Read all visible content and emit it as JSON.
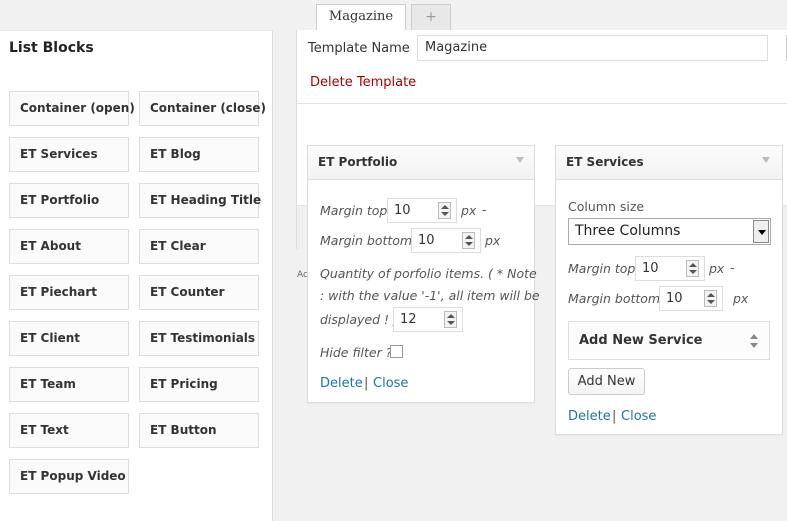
{
  "tabs": {
    "active": "Magazine",
    "add": "+"
  },
  "sidebar": {
    "title": "List Blocks",
    "blocks": [
      "Container (open)",
      "Container (close)",
      "ET Services",
      "ET Blog",
      "ET Portfolio",
      "ET Heading Title",
      "ET About",
      "ET Clear",
      "ET Piechart",
      "ET Counter",
      "ET Client",
      "ET Testimonials",
      "ET Team",
      "ET Pricing",
      "ET Text",
      "ET Button",
      "ET Popup Video"
    ]
  },
  "template": {
    "name_label": "Template Name",
    "name_value": "Magazine",
    "delete_label": "Delete Template"
  },
  "stub_text": "Ac",
  "portfolio": {
    "title": "ET Portfolio",
    "margin_top_label": "Margin top",
    "margin_top_value": "10",
    "margin_top_unit": "px",
    "margin_dash": "-",
    "margin_bottom_label": "Margin bottom",
    "margin_bottom_value": "10",
    "margin_bottom_unit": "px",
    "quantity_label_1": "Quantity of porfolio items. ( * Note",
    "quantity_label_2": ": with the value '-1', all item will be",
    "quantity_label_3": "displayed ! )",
    "quantity_value": "12",
    "hide_filter_label": "Hide filter ?",
    "delete_label": "Delete",
    "separator": "|",
    "close_label": "Close"
  },
  "services": {
    "title": "ET Services",
    "column_size_label": "Column size",
    "column_size_value": "Three Columns",
    "margin_top_label": "Margin top",
    "margin_top_value": "10",
    "margin_top_unit": "px",
    "margin_dash": "-",
    "margin_bottom_label": "Margin bottom",
    "margin_bottom_value": "10",
    "margin_bottom_unit": "px",
    "add_service_label": "Add New Service",
    "add_new_label": "Add New",
    "delete_label": "Delete",
    "separator": "|",
    "close_label": "Close"
  },
  "colors": {
    "link": "#21759b",
    "danger": "#aa0000",
    "panel": "#ffffff",
    "background": "#f1f1f1"
  }
}
